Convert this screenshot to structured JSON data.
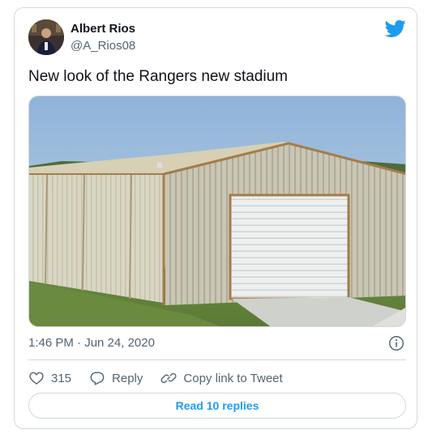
{
  "author": {
    "name": "Albert Rios",
    "handle": "@A_Rios08"
  },
  "tweet": {
    "text": "New look of the Rangers new stadium",
    "timestamp": "1:46 PM · Jun 24, 2020",
    "media_icon": "building-photo"
  },
  "actions": {
    "like_count": "315",
    "reply_label": "Reply",
    "copy_label": "Copy link to Tweet"
  },
  "footer": {
    "read_replies_label": "Read 10 replies"
  },
  "colors": {
    "brand": "#1d9bf0",
    "secondary_text": "#536471",
    "border": "#cfd9de"
  },
  "icons": [
    "twitter-bird-icon",
    "info-icon",
    "heart-icon",
    "reply-icon",
    "link-icon"
  ]
}
